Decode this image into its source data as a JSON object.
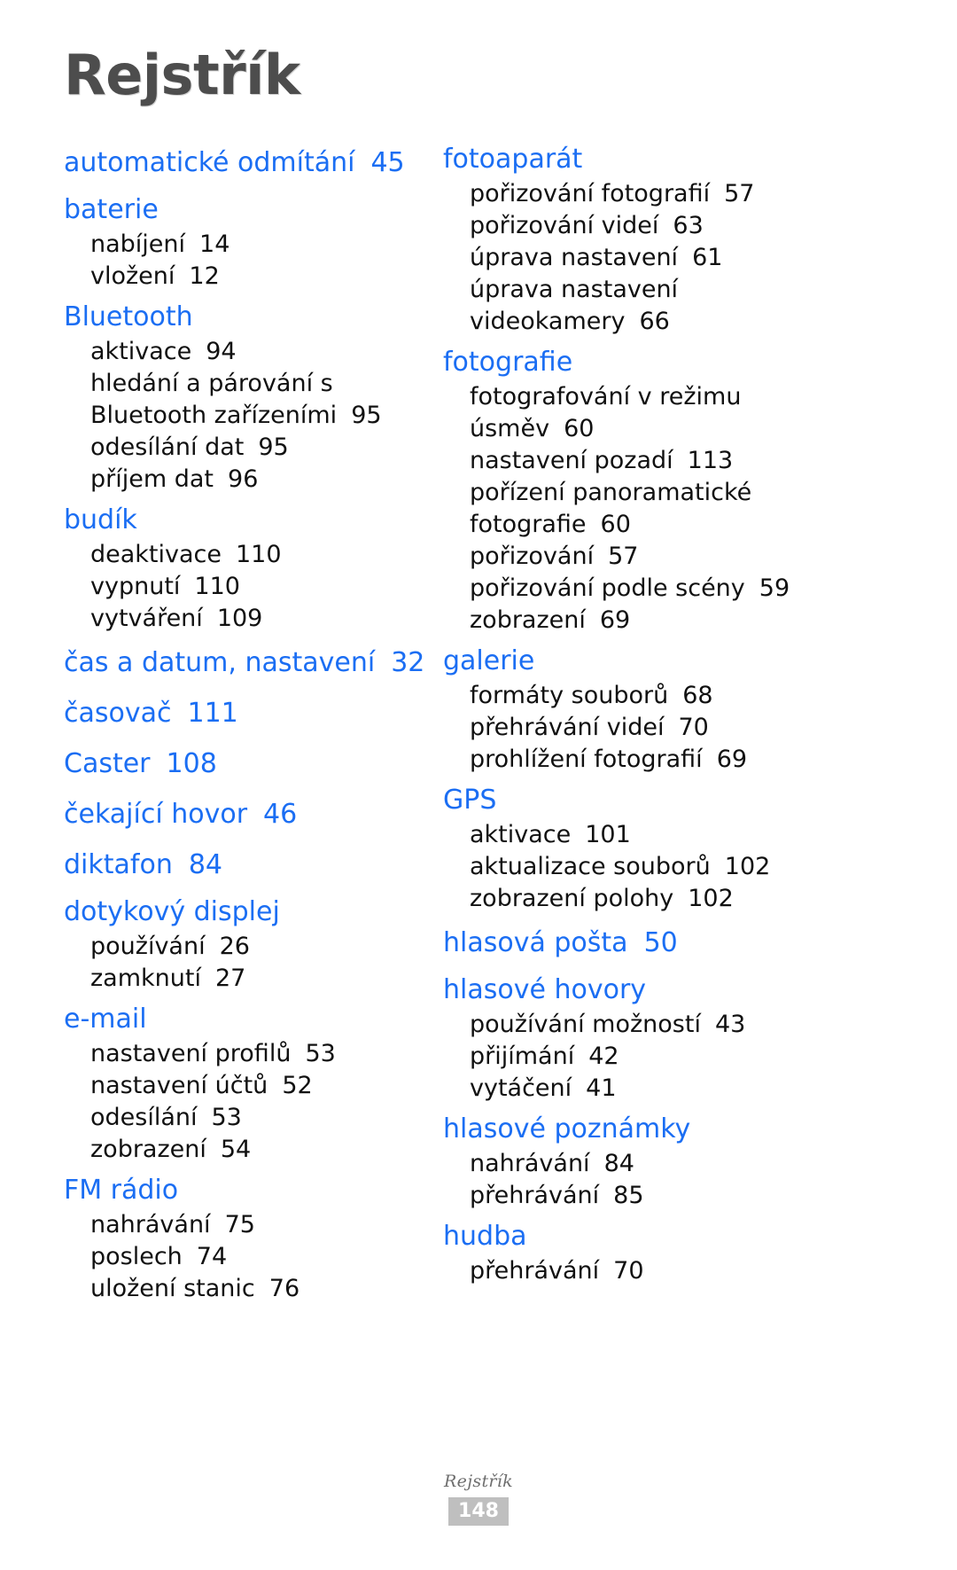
{
  "title": "Rejstřík",
  "footer": {
    "label": "Rejstřík",
    "page_number": "148"
  },
  "colors": {
    "heading_blue": "#1b6ef3",
    "sub_black": "#111111",
    "title_gray": "#4d4d4d",
    "badge_gray": "#bfbfbf"
  },
  "left_column": [
    {
      "head": "automatické odmítání",
      "head_page": "45",
      "subs": []
    },
    {
      "head": "baterie",
      "head_page": "",
      "subs": [
        {
          "label": "nabíjení",
          "page": "14"
        },
        {
          "label": "vložení",
          "page": "12"
        }
      ]
    },
    {
      "head": "Bluetooth",
      "head_page": "",
      "subs": [
        {
          "label": "aktivace",
          "page": "94"
        },
        {
          "label": "hledání a párování s",
          "page": ""
        },
        {
          "label": "Bluetooth zařízeními",
          "page": "95",
          "cont": true
        },
        {
          "label": "odesílání dat",
          "page": "95"
        },
        {
          "label": "příjem dat",
          "page": "96"
        }
      ]
    },
    {
      "head": "budík",
      "head_page": "",
      "subs": [
        {
          "label": "deaktivace",
          "page": "110"
        },
        {
          "label": "vypnutí",
          "page": "110"
        },
        {
          "label": "vytváření",
          "page": "109"
        }
      ]
    },
    {
      "head": "čas a datum, nastavení",
      "head_page": "32",
      "subs": []
    },
    {
      "head": "časovač",
      "head_page": "111",
      "subs": []
    },
    {
      "head": "Caster",
      "head_page": "108",
      "subs": []
    },
    {
      "head": "čekající hovor",
      "head_page": "46",
      "subs": []
    },
    {
      "head": "diktafon",
      "head_page": "84",
      "subs": []
    },
    {
      "head": "dotykový displej",
      "head_page": "",
      "subs": [
        {
          "label": "používání",
          "page": "26"
        },
        {
          "label": "zamknutí",
          "page": "27"
        }
      ]
    },
    {
      "head": "e-mail",
      "head_page": "",
      "subs": [
        {
          "label": "nastavení profilů",
          "page": "53"
        },
        {
          "label": "nastavení účtů",
          "page": "52"
        },
        {
          "label": "odesílání",
          "page": "53"
        },
        {
          "label": "zobrazení",
          "page": "54"
        }
      ]
    },
    {
      "head": "FM rádio",
      "head_page": "",
      "subs": [
        {
          "label": "nahrávání",
          "page": "75"
        },
        {
          "label": "poslech",
          "page": "74"
        },
        {
          "label": "uložení stanic",
          "page": "76"
        }
      ]
    }
  ],
  "right_column": [
    {
      "head": "fotoaparát",
      "head_page": "",
      "subs": [
        {
          "label": "pořizování fotografií",
          "page": "57"
        },
        {
          "label": "pořizování videí",
          "page": "63"
        },
        {
          "label": "úprava nastavení",
          "page": "61"
        },
        {
          "label": "úprava nastavení",
          "page": ""
        },
        {
          "label": "videokamery",
          "page": "66",
          "cont": true
        }
      ]
    },
    {
      "head": "fotografie",
      "head_page": "",
      "subs": [
        {
          "label": "fotografování v režimu",
          "page": ""
        },
        {
          "label": "úsměv",
          "page": "60",
          "cont": true
        },
        {
          "label": "nastavení pozadí",
          "page": "113"
        },
        {
          "label": "pořízení panoramatické",
          "page": ""
        },
        {
          "label": "fotografie",
          "page": "60",
          "cont": true
        },
        {
          "label": "pořizování",
          "page": "57"
        },
        {
          "label": "pořizování podle scény",
          "page": "59"
        },
        {
          "label": "zobrazení",
          "page": "69"
        }
      ]
    },
    {
      "head": "galerie",
      "head_page": "",
      "subs": [
        {
          "label": "formáty souborů",
          "page": "68"
        },
        {
          "label": "přehrávání videí",
          "page": "70"
        },
        {
          "label": "prohlížení fotografií",
          "page": "69"
        }
      ]
    },
    {
      "head": "GPS",
      "head_page": "",
      "subs": [
        {
          "label": "aktivace",
          "page": "101"
        },
        {
          "label": "aktualizace souborů",
          "page": "102"
        },
        {
          "label": "zobrazení polohy",
          "page": "102"
        }
      ]
    },
    {
      "head": "hlasová pošta",
      "head_page": "50",
      "subs": []
    },
    {
      "head": "hlasové hovory",
      "head_page": "",
      "subs": [
        {
          "label": "používání možností",
          "page": "43"
        },
        {
          "label": "přijímání",
          "page": "42"
        },
        {
          "label": "vytáčení",
          "page": "41"
        }
      ]
    },
    {
      "head": "hlasové poznámky",
      "head_page": "",
      "subs": [
        {
          "label": "nahrávání",
          "page": "84"
        },
        {
          "label": "přehrávání",
          "page": "85"
        }
      ]
    },
    {
      "head": "hudba",
      "head_page": "",
      "subs": [
        {
          "label": "přehrávání",
          "page": "70"
        }
      ]
    }
  ]
}
